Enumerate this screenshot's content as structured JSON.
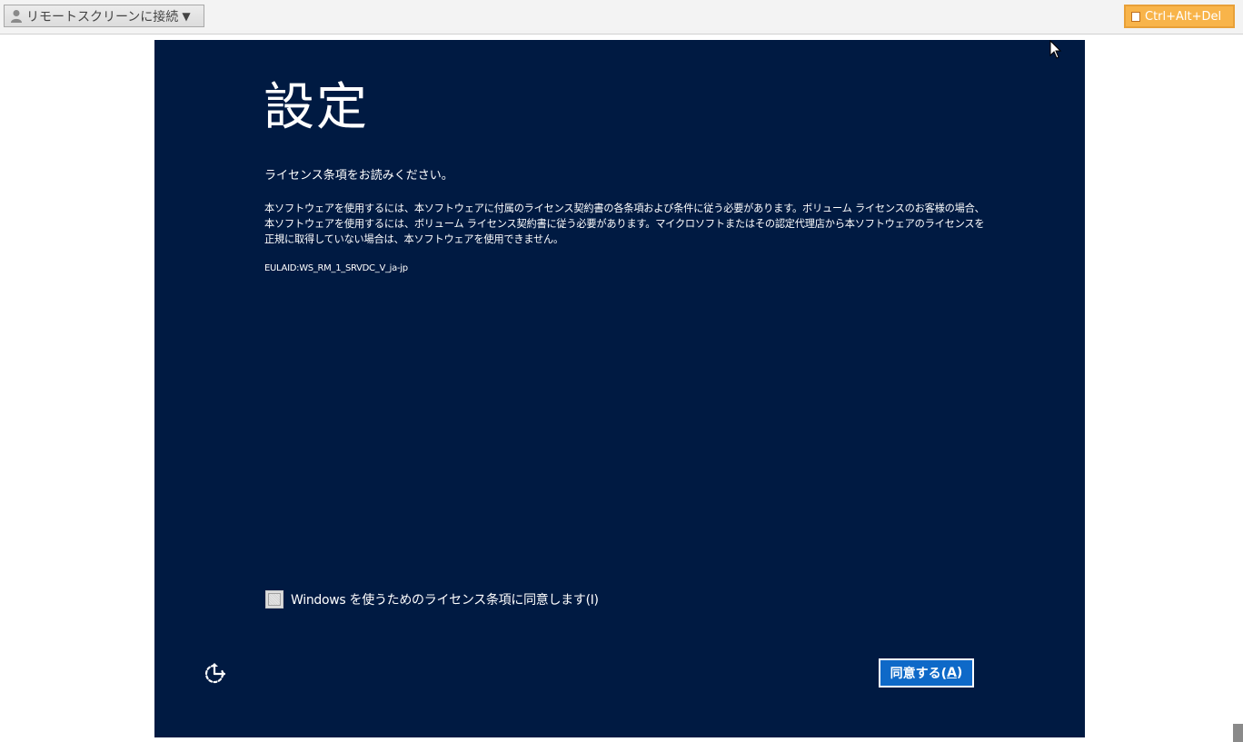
{
  "toolbar": {
    "connect_label": "リモートスクリーンに接続",
    "connect_caret": "▼",
    "cad_label": "Ctrl+Alt+Del"
  },
  "setup": {
    "title": "設定",
    "subtitle": "ライセンス条項をお読みください。",
    "body": "本ソフトウェアを使用するには、本ソフトウェアに付属のライセンス契約書の各条項および条件に従う必要があります。ボリューム ライセンスのお客様の場合、本ソフトウェアを使用するには、ボリューム ライセンス契約書に従う必要があります。マイクロソフトまたはその認定代理店から本ソフトウェアのライセンスを正規に取得していない場合は、本ソフトウェアを使用できません。",
    "eula_id": "EULAID:WS_RM_1_SRVDC_V_ja-jp",
    "agree_checkbox_label": "Windows を使うためのライセンス条項に同意します(I)",
    "agree_checked": false,
    "accept_button_main": "同意する(",
    "accept_button_accel": "A",
    "accept_button_end": ")"
  },
  "colors": {
    "screen_bg": "#001a42",
    "accept_button_bg": "#0e69c8",
    "cad_button_bg": "#f8b44a",
    "toolbar_bg": "#f3f3f3"
  },
  "icons": {
    "user": "user-icon",
    "keyboard": "keyboard-icon",
    "ease_of_access": "ease-of-access-icon",
    "cursor": "mouse-cursor-icon"
  }
}
